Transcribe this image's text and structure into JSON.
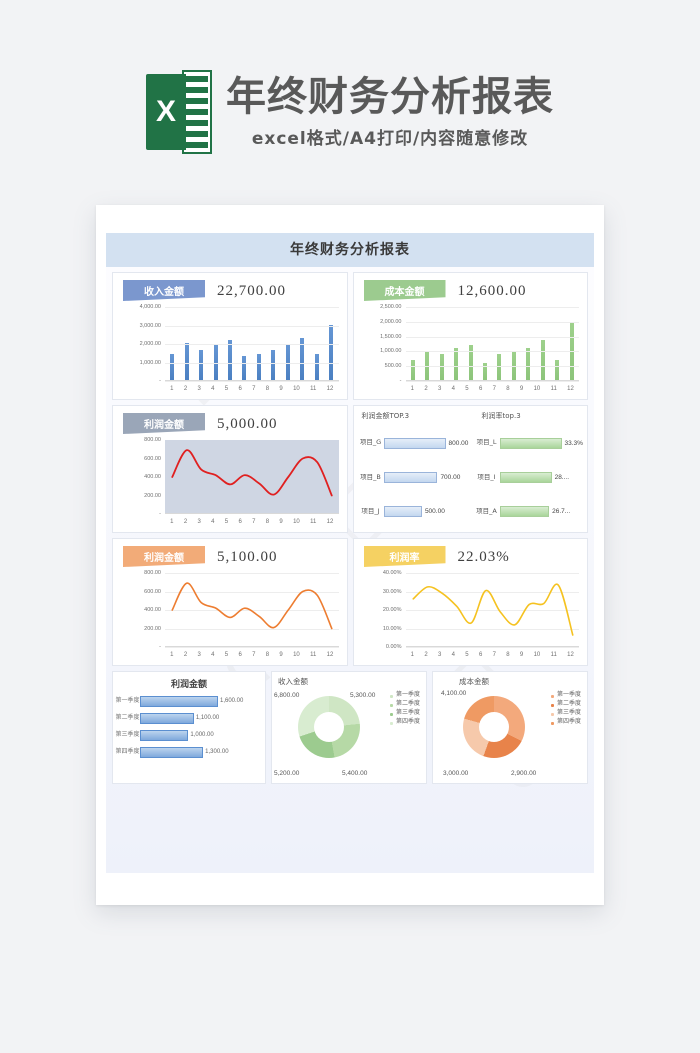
{
  "promo": {
    "logo_letter": "X",
    "title": "年终财务分析报表",
    "subtitle": "excel格式/A4打印/内容随意修改"
  },
  "document": {
    "title": "年终财务分析报表"
  },
  "kpi": {
    "income_label": "收入金额",
    "income_value": "22,700.00",
    "cost_label": "成本金额",
    "cost_value": "12,600.00",
    "profit_label": "利润金额",
    "profit_value": "5,000.00",
    "profit2_label": "利润金额",
    "profit2_value": "5,100.00",
    "margin_label": "利润率",
    "margin_value": "22.03%"
  },
  "top3": {
    "amount_title": "利润金额TOP.3",
    "rate_title": "利润率top.3",
    "amount_rows": [
      {
        "label": "项目_G",
        "value": "800.00",
        "pct": 100
      },
      {
        "label": "项目_B",
        "value": "700.00",
        "pct": 87
      },
      {
        "label": "项目_J",
        "value": "500.00",
        "pct": 62
      }
    ],
    "rate_rows": [
      {
        "label": "项目_L",
        "value": "33.3%",
        "pct": 100
      },
      {
        "label": "项目_I",
        "value": "28....",
        "pct": 84
      },
      {
        "label": "项目_A",
        "value": "26.7...",
        "pct": 80
      }
    ]
  },
  "quarter_bars": {
    "title": "利润金额",
    "rows": [
      {
        "label": "第一季度",
        "value": "1,600.00",
        "pct": 100
      },
      {
        "label": "第二季度",
        "value": "1,100.00",
        "pct": 69
      },
      {
        "label": "第三季度",
        "value": "1,000.00",
        "pct": 62
      },
      {
        "label": "第四季度",
        "value": "1,300.00",
        "pct": 81
      }
    ]
  },
  "donut_income": {
    "title": "收入金额",
    "labels": [
      "5,300.00",
      "5,400.00",
      "5,200.00",
      "6,800.00"
    ],
    "legend": [
      "第一季度",
      "第二季度",
      "第三季度",
      "第四季度"
    ]
  },
  "donut_cost": {
    "title": "成本金额",
    "labels": [
      "4,100.00",
      "2,900.00",
      "3,000.00"
    ],
    "legend": [
      "第一季度",
      "第二季度",
      "第三季度",
      "第四季度"
    ]
  },
  "colors": {
    "income_accent": "#7b97ce",
    "cost_accent": "#9ccb8f",
    "profit_accent": "#9aa6b8",
    "profit2_accent": "#f2ab78",
    "margin_accent": "#f5d162",
    "excel_green": "#217346",
    "line_red": "#e02020",
    "line_orange": "#ed7d31",
    "line_yellow": "#f5c220"
  },
  "chart_data": [
    {
      "type": "bar",
      "title": "收入金额",
      "categories": [
        "1",
        "2",
        "3",
        "4",
        "5",
        "6",
        "7",
        "8",
        "9",
        "10",
        "11",
        "12"
      ],
      "values": [
        1450,
        2050,
        1700,
        1950,
        2200,
        1350,
        1450,
        1700,
        2000,
        2300,
        1450,
        3050
      ],
      "yticks": [
        "4,000.00",
        "3,000.00",
        "2,000.00",
        "1,000.00",
        "-"
      ],
      "ylim": [
        0,
        4000
      ],
      "xlabel": "",
      "ylabel": "",
      "grid": true,
      "color": "#4a7fc1"
    },
    {
      "type": "bar",
      "title": "成本金额",
      "categories": [
        "1",
        "2",
        "3",
        "4",
        "5",
        "6",
        "7",
        "8",
        "9",
        "10",
        "11",
        "12"
      ],
      "values": [
        700,
        1000,
        900,
        1100,
        1200,
        620,
        900,
        1000,
        1100,
        1400,
        720,
        2000
      ],
      "yticks": [
        "2,500.00",
        "2,000.00",
        "1,500.00",
        "1,000.00",
        "500.00",
        "-"
      ],
      "ylim": [
        0,
        2500
      ],
      "xlabel": "",
      "ylabel": "",
      "grid": true,
      "color": "#8cc47a"
    },
    {
      "type": "line",
      "title": "利润金额",
      "categories": [
        "1",
        "2",
        "3",
        "4",
        "5",
        "6",
        "7",
        "8",
        "9",
        "10",
        "11",
        "12"
      ],
      "values": [
        400,
        690,
        480,
        420,
        320,
        420,
        330,
        210,
        400,
        600,
        560,
        200
      ],
      "yticks": [
        "800.00",
        "600.00",
        "400.00",
        "200.00",
        "-"
      ],
      "ylim": [
        0,
        800
      ],
      "grid": true,
      "color": "#e02020"
    },
    {
      "type": "bar",
      "title": "利润金额TOP.3",
      "categories": [
        "项目_G",
        "项目_B",
        "项目_J"
      ],
      "values": [
        800,
        700,
        500
      ],
      "orientation": "horizontal",
      "color": "#9ab4da"
    },
    {
      "type": "bar",
      "title": "利润率top.3",
      "categories": [
        "项目_L",
        "项目_I",
        "项目_A"
      ],
      "values": [
        33.3,
        28.0,
        26.7
      ],
      "orientation": "horizontal",
      "color": "#a9d59a"
    },
    {
      "type": "line",
      "title": "利润金额",
      "categories": [
        "1",
        "2",
        "3",
        "4",
        "5",
        "6",
        "7",
        "8",
        "9",
        "10",
        "11",
        "12"
      ],
      "values": [
        400,
        690,
        480,
        420,
        320,
        420,
        330,
        210,
        400,
        600,
        560,
        200
      ],
      "yticks": [
        "800.00",
        "600.00",
        "400.00",
        "200.00",
        "-"
      ],
      "ylim": [
        0,
        800
      ],
      "grid": true,
      "color": "#ed7d31"
    },
    {
      "type": "line",
      "title": "利润率",
      "categories": [
        "1",
        "2",
        "3",
        "4",
        "5",
        "6",
        "7",
        "8",
        "9",
        "10",
        "11",
        "12"
      ],
      "values": [
        26.0,
        32.5,
        29.0,
        22.0,
        13.0,
        30.5,
        19.0,
        12.0,
        23.0,
        23.5,
        33.5,
        6.5
      ],
      "yticks": [
        "40.00%",
        "30.00%",
        "20.00%",
        "10.00%",
        "0.00%"
      ],
      "ylim": [
        0,
        40
      ],
      "grid": true,
      "color": "#f5c220"
    },
    {
      "type": "bar",
      "title": "利润金额",
      "categories": [
        "第一季度",
        "第二季度",
        "第三季度",
        "第四季度"
      ],
      "values": [
        1600,
        1100,
        1000,
        1300
      ],
      "orientation": "horizontal",
      "color": "#7fa9dc"
    },
    {
      "type": "pie",
      "title": "收入金额",
      "categories": [
        "第一季度",
        "第二季度",
        "第三季度",
        "第四季度"
      ],
      "values": [
        5300,
        5400,
        5200,
        6800
      ],
      "legend_position": "right",
      "color": "#a9d59a"
    },
    {
      "type": "pie",
      "title": "成本金额",
      "categories": [
        "第一季度",
        "第二季度",
        "第三季度",
        "第四季度"
      ],
      "values": [
        4100,
        2900,
        3000,
        2600
      ],
      "legend_position": "right",
      "color": "#e8834a"
    }
  ]
}
